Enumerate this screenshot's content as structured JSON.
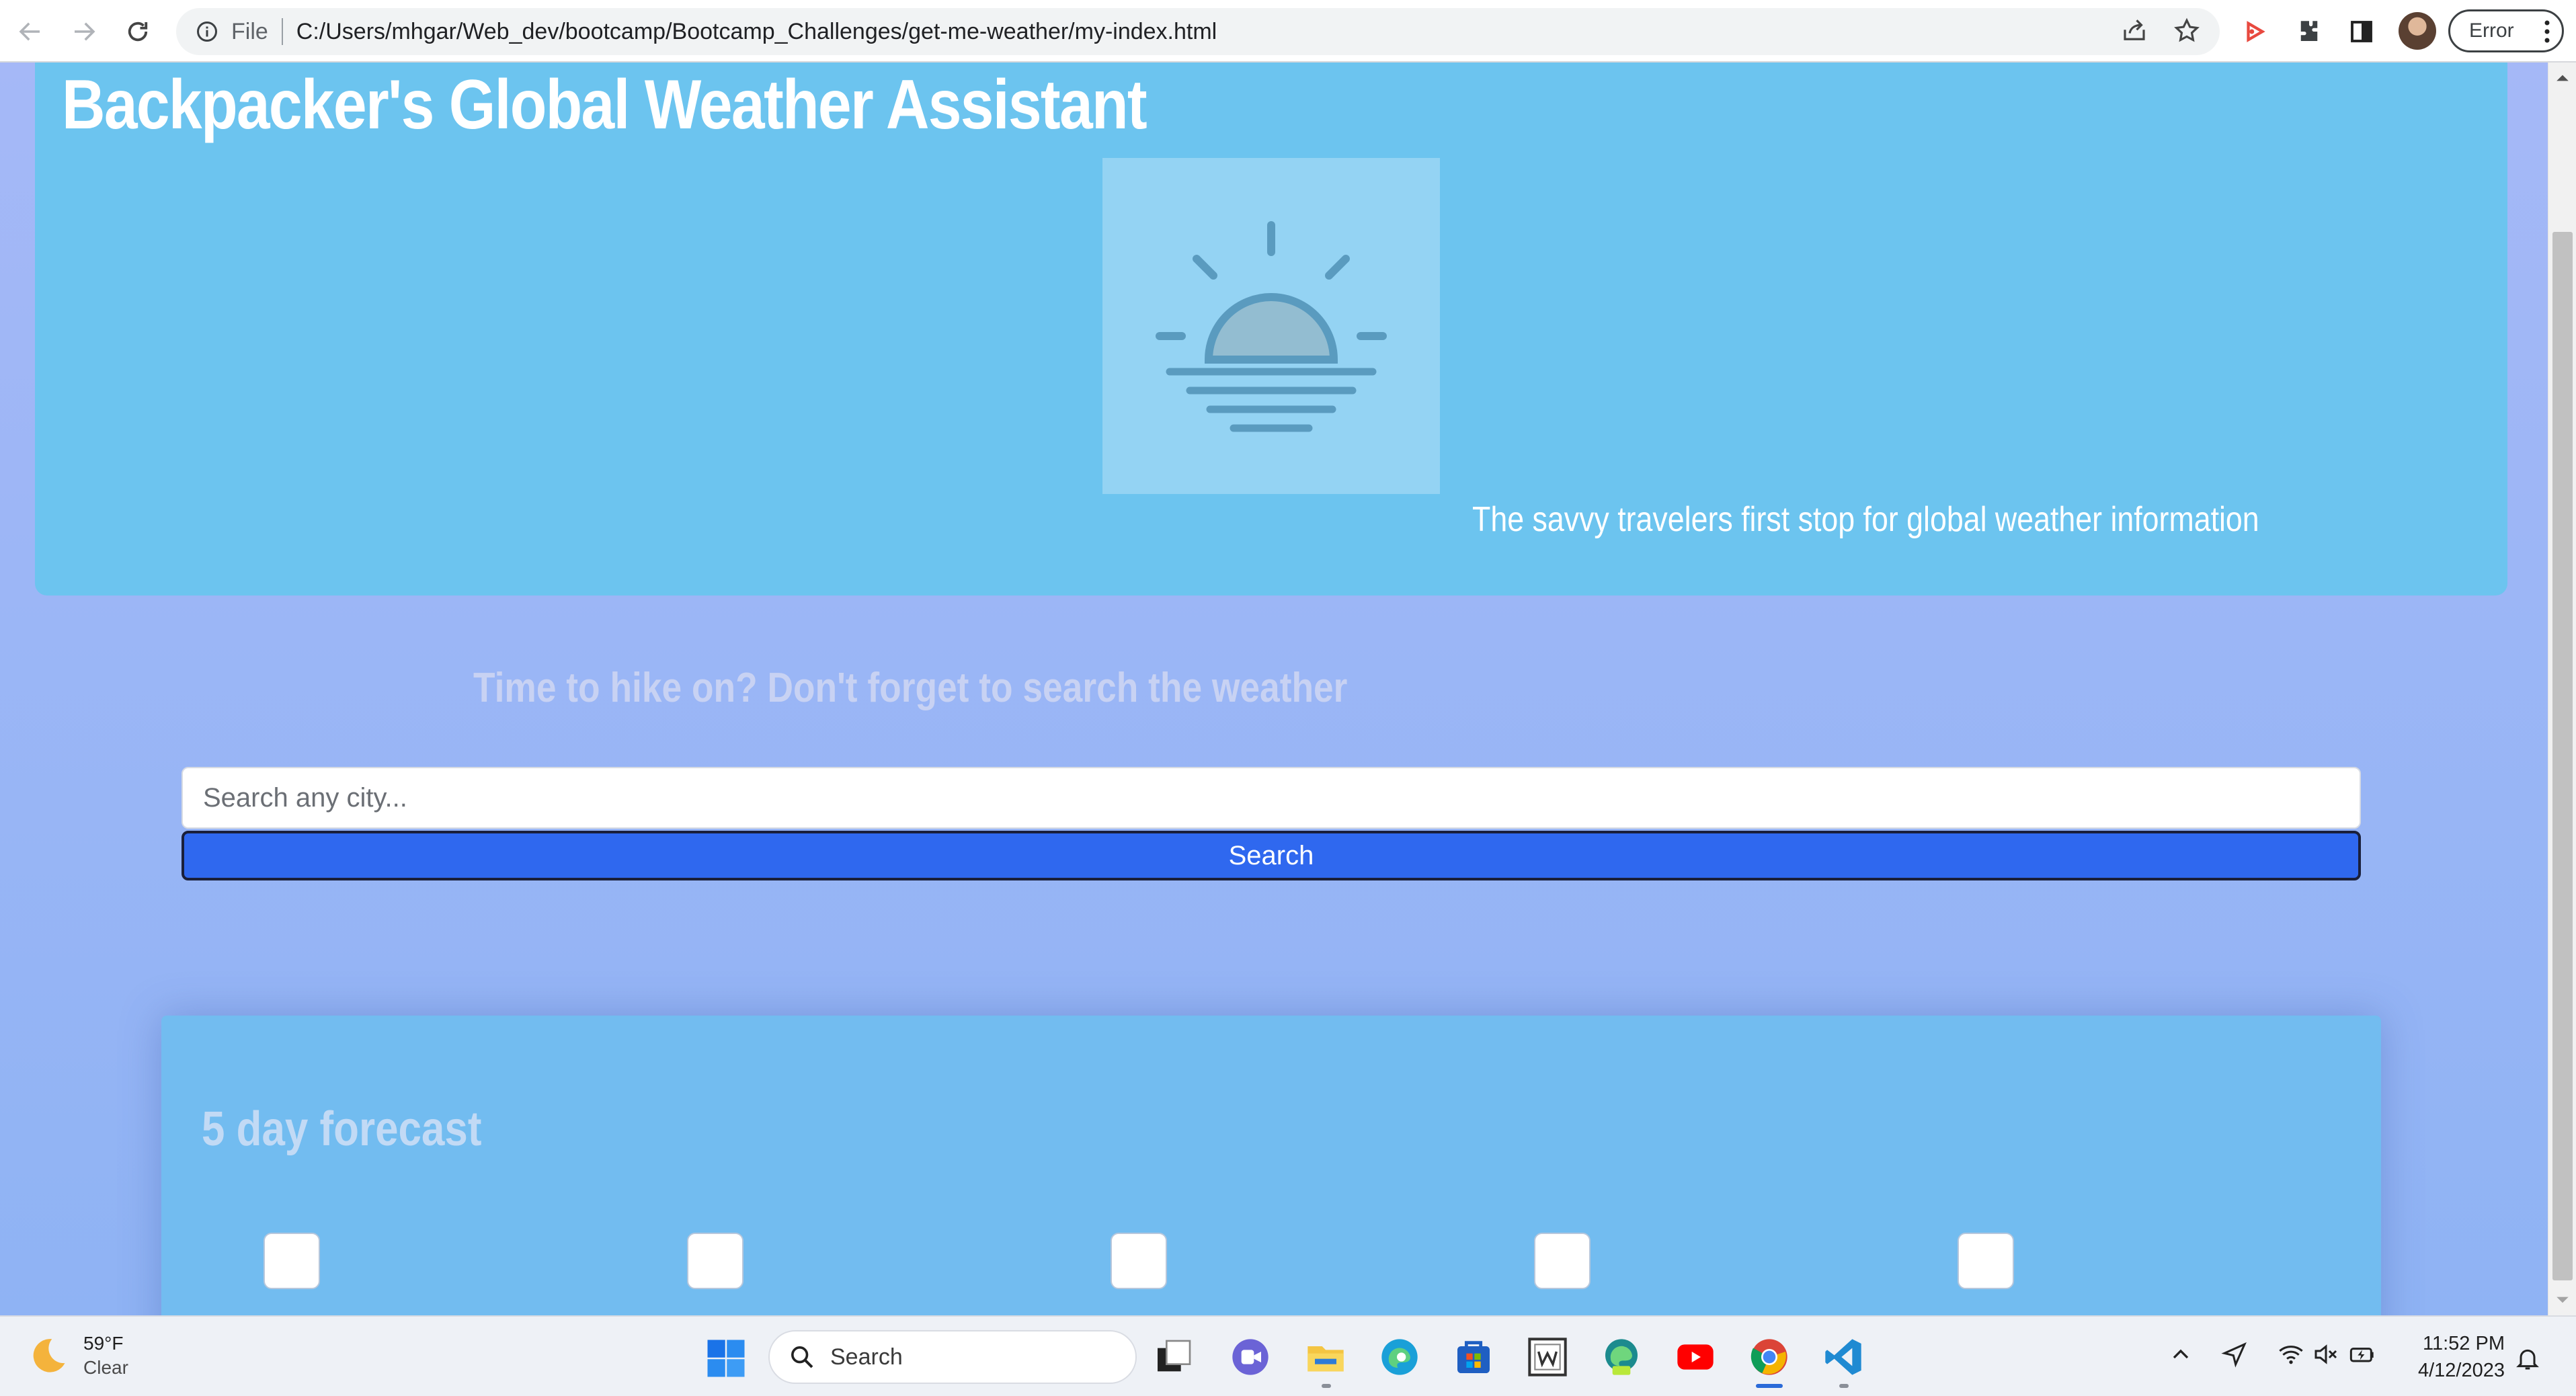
{
  "browser": {
    "file_label": "File",
    "url": "C:/Users/mhgar/Web_dev/bootcamp/Bootcamp_Challenges/get-me-weather/my-index.html",
    "profile_status": "Error"
  },
  "page": {
    "title": "Backpacker's Global Weather Assistant",
    "tagline": "The savvy travelers first stop for global weather information",
    "prompt": "Time to hike on? Don't forget to search the weather",
    "search": {
      "placeholder": "Search any city...",
      "button_label": "Search"
    },
    "forecast": {
      "title": "5 day forecast",
      "day_count": 5
    },
    "colors": {
      "hero_bg": "#6cc4ef",
      "page_bg": "#9ab6f6",
      "button_bg": "#2f68ef",
      "forecast_bg": "#72bcf0"
    }
  },
  "taskbar": {
    "weather_temp": "59°F",
    "weather_condition": "Clear",
    "search_label": "Search",
    "time": "11:52 PM",
    "date": "4/12/2023",
    "apps": [
      "task-view-icon",
      "chat-icon",
      "file-explorer-icon",
      "edge-icon",
      "store-icon",
      "word-icon",
      "edge-dev-icon",
      "youtube-icon",
      "chrome-icon",
      "vscode-icon"
    ]
  }
}
